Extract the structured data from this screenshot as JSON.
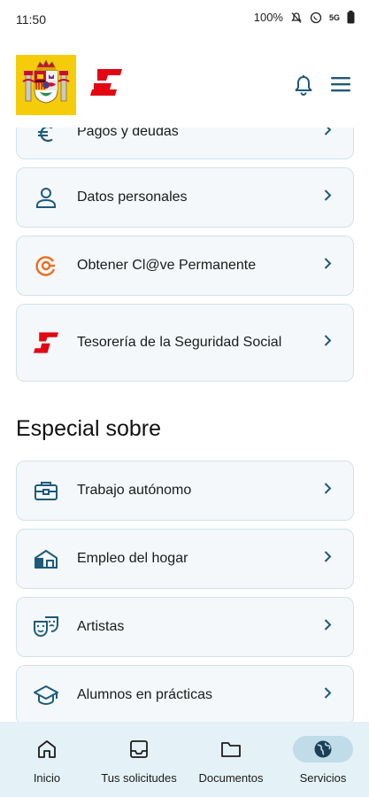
{
  "status": {
    "time": "11:50",
    "battery": "100%",
    "network": "5G"
  },
  "header": {
    "coat_icon": "spain-coat-of-arms",
    "brand_icon": "seguridad-social-logo",
    "brand_color": "#e30613",
    "bell_icon": "bell-icon",
    "menu_icon": "menu-icon"
  },
  "services": [
    {
      "label": "Pagos y deudas",
      "icon": "euro-icon"
    },
    {
      "label": "Datos personales",
      "icon": "person-icon"
    },
    {
      "label": "Obtener Cl@ve Permanente",
      "icon": "clave-icon"
    },
    {
      "label": "Tesorería de la Seguridad Social",
      "icon": "tgss-logo-icon"
    }
  ],
  "special": {
    "title": "Especial sobre",
    "items": [
      {
        "label": "Trabajo autónomo",
        "icon": "briefcase-icon"
      },
      {
        "label": "Empleo del hogar",
        "icon": "house-icon"
      },
      {
        "label": "Artistas",
        "icon": "theater-masks-icon"
      },
      {
        "label": "Alumnos en prácticas",
        "icon": "graduation-cap-icon"
      }
    ]
  },
  "bottom_nav": {
    "items": [
      {
        "label": "Inicio",
        "icon": "home-icon",
        "active": false
      },
      {
        "label": "Tus solicitudes",
        "icon": "inbox-icon",
        "active": false
      },
      {
        "label": "Documentos",
        "icon": "folder-icon",
        "active": false
      },
      {
        "label": "Servicios",
        "icon": "globe-icon",
        "active": true
      }
    ]
  },
  "colors": {
    "icon_blue": "#1d5a7a",
    "card_bg": "#f4f8fa",
    "card_border": "#d3e1e8",
    "nav_bg": "#e4f1f6",
    "nav_active": "#bfdce8",
    "clave_orange": "#ef6a1a"
  }
}
